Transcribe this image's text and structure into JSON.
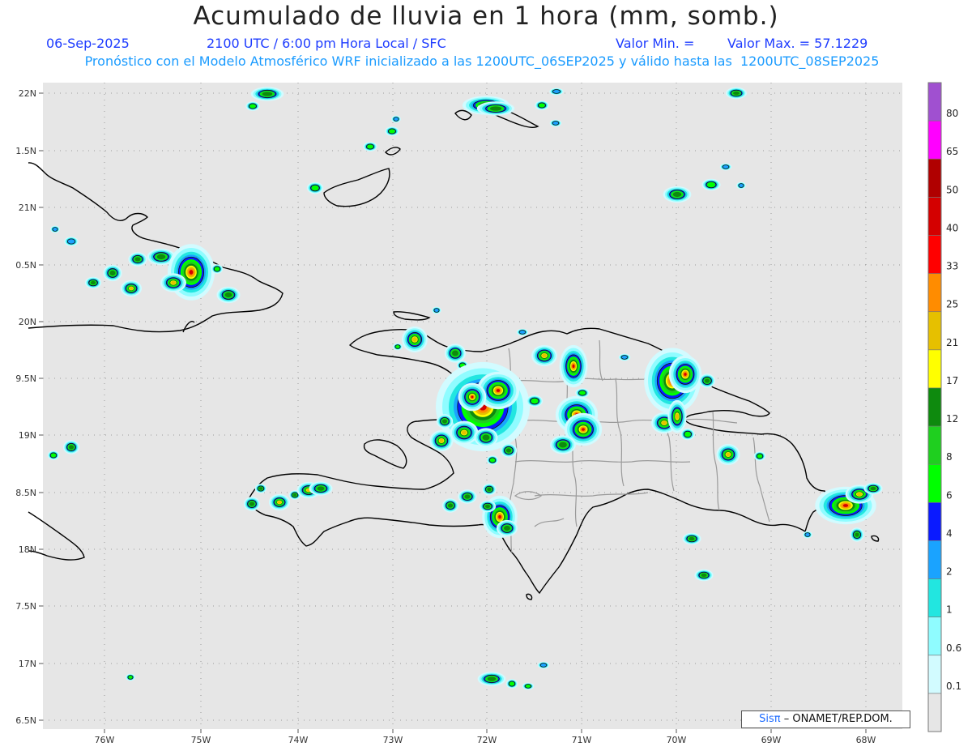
{
  "title": "Acumulado de lluvia en 1 hora (mm, somb.)",
  "header": {
    "date": "06-Sep-2025",
    "time": "2100 UTC / 6:00 pm Hora Local / SFC",
    "min_label": "Valor Min. =",
    "max_label": "Valor Max. = 57.1229",
    "forecast": "Pronóstico con el Modelo Atmosférico WRF inicializado a las 1200UTC_06SEP2025 y válido hasta las  1200UTC_08SEP2025"
  },
  "lat_labels": [
    "22N",
    "1.5N",
    "21N",
    "0.5N",
    "20N",
    "9.5N",
    "19N",
    "8.5N",
    "18N",
    "7.5N",
    "17N",
    "6.5N"
  ],
  "lon_labels": [
    "76W",
    "75W",
    "74W",
    "73W",
    "72W",
    "71W",
    "70W",
    "69W",
    "68W"
  ],
  "colorbar": {
    "labels": [
      "0.1",
      "0.6",
      "1",
      "2",
      "4",
      "6",
      "8",
      "12",
      "17",
      "21",
      "25",
      "33",
      "40",
      "50",
      "65",
      "80"
    ],
    "colors": [
      "#e6e6e6",
      "#d2fbff",
      "#8ffcff",
      "#22e6e0",
      "#1aa3ff",
      "#0a1aff",
      "#00ff00",
      "#1fcf1f",
      "#0e8a0e",
      "#ffff00",
      "#e6c000",
      "#ff8c00",
      "#ff0000",
      "#d40000",
      "#b00000",
      "#ff00ff",
      "#a050d0"
    ]
  },
  "credit": {
    "brand": "Sisπ",
    "text": "– ONAMET/REP.DOM."
  }
}
